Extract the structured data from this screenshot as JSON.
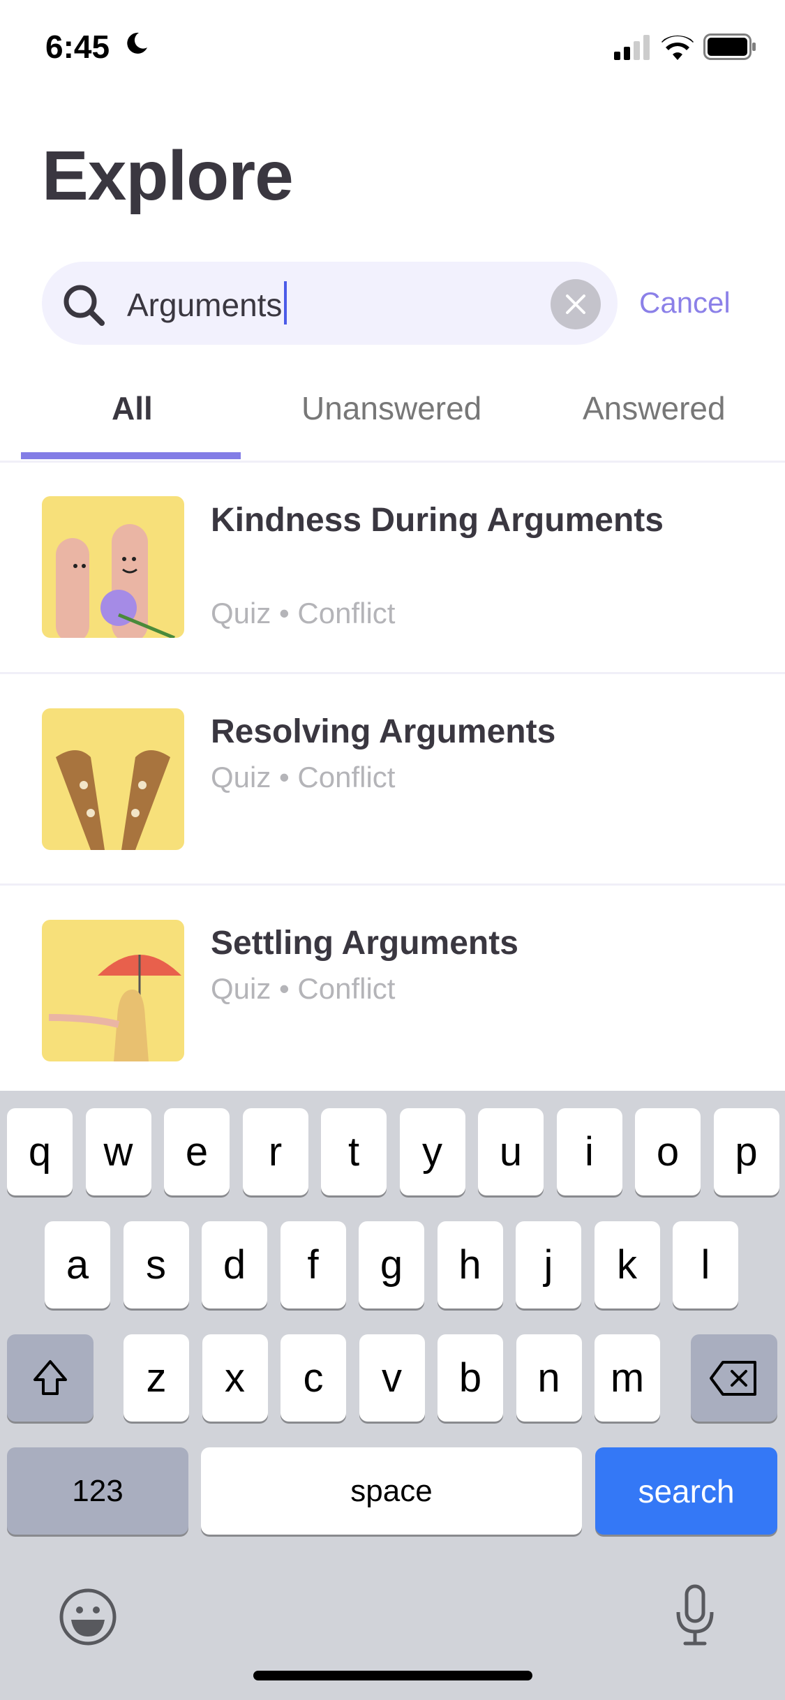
{
  "status_bar": {
    "time": "6:45",
    "icons": [
      "moon-icon",
      "signal-icon",
      "wifi-icon",
      "battery-icon"
    ]
  },
  "header": {
    "title": "Explore"
  },
  "search": {
    "value": "Arguments",
    "cancel_label": "Cancel",
    "icon": "search-icon",
    "clear_icon": "clear-icon"
  },
  "tabs": [
    {
      "label": "All",
      "active": true
    },
    {
      "label": "Unanswered",
      "active": false
    },
    {
      "label": "Answered",
      "active": false
    }
  ],
  "results": [
    {
      "title": "Kindness During Arguments",
      "type": "Quiz",
      "category": "Conflict",
      "meta": "Quiz • Conflict"
    },
    {
      "title": "Resolving Arguments",
      "type": "Quiz",
      "category": "Conflict",
      "meta": "Quiz • Conflict"
    },
    {
      "title": "Settling Arguments",
      "type": "Quiz",
      "category": "Conflict",
      "meta": "Quiz • Conflict"
    }
  ],
  "keyboard": {
    "row1": [
      "q",
      "w",
      "e",
      "r",
      "t",
      "y",
      "u",
      "i",
      "o",
      "p"
    ],
    "row2": [
      "a",
      "s",
      "d",
      "f",
      "g",
      "h",
      "j",
      "k",
      "l"
    ],
    "row3": [
      "z",
      "x",
      "c",
      "v",
      "b",
      "n",
      "m"
    ],
    "numbers_label": "123",
    "space_label": "space",
    "search_label": "search"
  },
  "colors": {
    "accent": "#837de6",
    "search_key": "#3478f6",
    "thumb_bg": "#f7e07a"
  }
}
